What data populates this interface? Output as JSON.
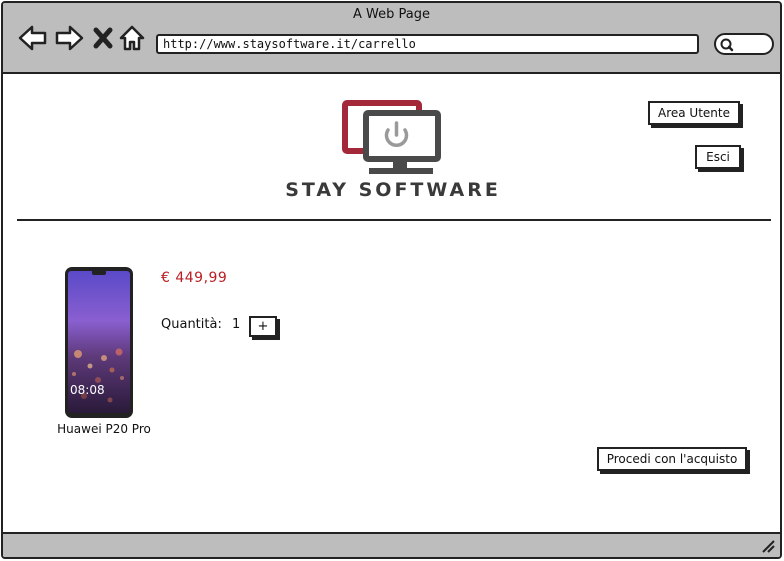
{
  "window": {
    "title": "A Web Page",
    "url": "http://www.staysoftware.it/carrello"
  },
  "toolbar": {
    "back_icon": "arrow-left-icon",
    "forward_icon": "arrow-right-icon",
    "stop_icon": "close-icon",
    "home_icon": "home-icon",
    "search_icon": "search-icon"
  },
  "header": {
    "logo_text": "STAY SOFTWARE",
    "area_utente_label": "Area Utente",
    "esci_label": "Esci"
  },
  "cart": {
    "product_name": "Huawei P20 Pro",
    "price": "€ 449,99",
    "quantity_label": "Quantità:",
    "quantity_value": "1",
    "plus_label": "+",
    "checkout_label": "Procedi con l'acquisto",
    "phone_clock": "08:08"
  },
  "colors": {
    "chrome": "#bdbdbd",
    "price": "#b81f24",
    "logo_red": "#a3283a",
    "logo_gray": "#4a4a4a"
  }
}
